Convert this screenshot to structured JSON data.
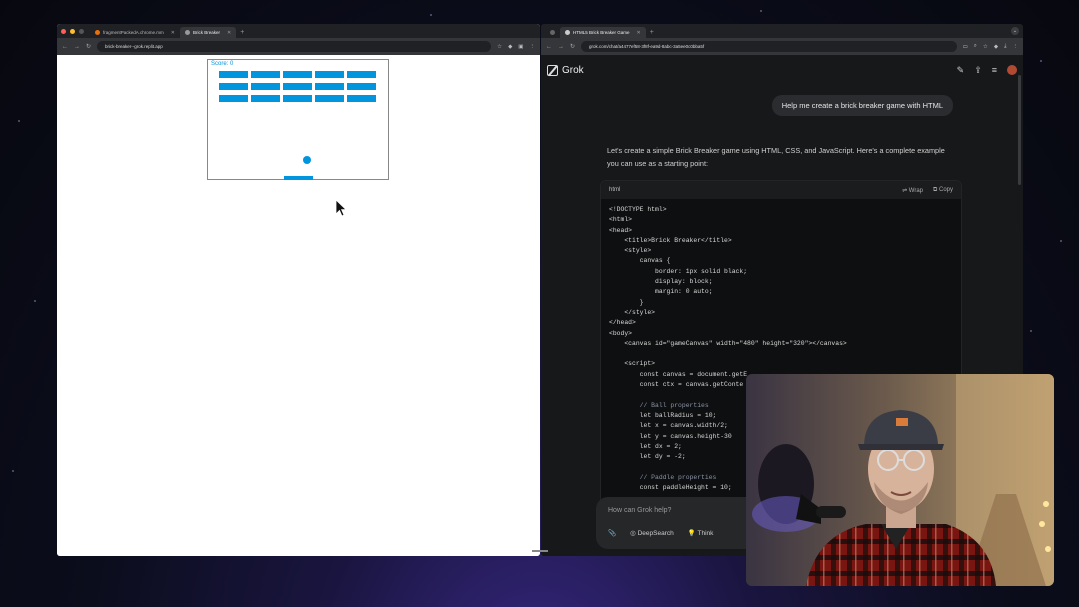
{
  "left_window": {
    "tabs": [
      {
        "label": "fragmentPackedA.chrome.mm",
        "active": false
      },
      {
        "label": "Brick Breaker",
        "active": true
      }
    ],
    "url": "brick-breaker--grok.replit.app",
    "game": {
      "score_label": "Score: 0",
      "brick_rows": 3,
      "brick_cols": 5,
      "color": "#0095DD"
    }
  },
  "right_window": {
    "tabs": [
      {
        "label": "HTML5 Brick Breaker Game",
        "active": true
      }
    ],
    "url": "grok.com/chat/a4477ef58-3f8f-ea9d-8abc-3a5ee0c0bba5f",
    "app_name": "Grok",
    "user_message": "Help me create a brick breaker game with HTML",
    "assistant_intro": "Let's create a simple Brick Breaker game using HTML, CSS, and JavaScript. Here's a complete example you can use as a starting point:",
    "code_block": {
      "language": "html",
      "wrap_label": "Wrap",
      "copy_label": "Copy",
      "lines": [
        "<!DOCTYPE html>",
        "<html>",
        "<head>",
        "    <title>Brick Breaker</title>",
        "    <style>",
        "        canvas {",
        "            border: 1px solid black;",
        "            display: block;",
        "            margin: 0 auto;",
        "        }",
        "    </style>",
        "</head>",
        "<body>",
        "    <canvas id=\"gameCanvas\" width=\"480\" height=\"320\"></canvas>",
        "",
        "    <script>",
        "        const canvas = document.getE",
        "        const ctx = canvas.getConte",
        "",
        "        // Ball properties",
        "        let ballRadius = 10;",
        "        let x = canvas.width/2;",
        "        let y = canvas.height-30",
        "        let dx = 2;",
        "        let dy = -2;",
        "",
        "        // Paddle properties",
        "        const paddleHeight = 10;"
      ]
    },
    "composer": {
      "placeholder": "How can Grok help?",
      "deepsearch_label": "DeepSearch",
      "think_label": "Think"
    }
  },
  "webcam": {
    "description_icon": "webcam-feed"
  }
}
